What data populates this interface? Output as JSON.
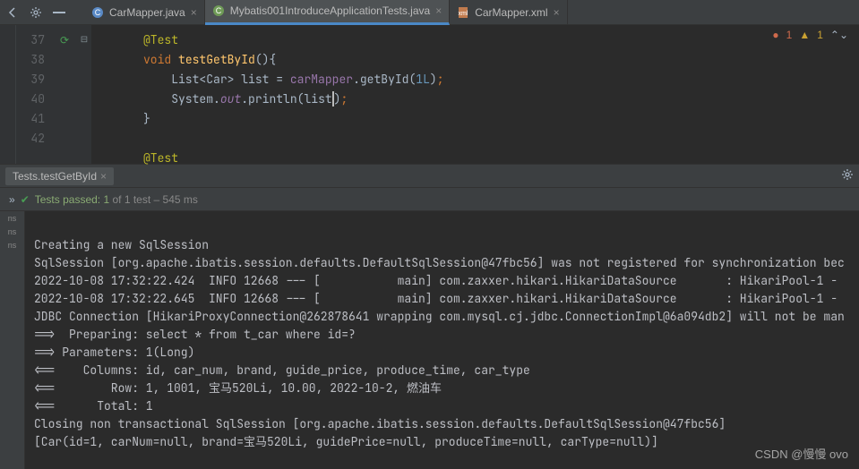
{
  "toolbar": {
    "tabs": [
      {
        "label": "CarMapper.java",
        "type": "java",
        "active": false
      },
      {
        "label": "Mybatis001IntroduceApplicationTests.java",
        "type": "java",
        "active": true
      },
      {
        "label": "CarMapper.xml",
        "type": "xml",
        "active": false
      }
    ]
  },
  "editor": {
    "badges": {
      "errors": "1",
      "warnings": "1"
    },
    "lines": [
      {
        "n": "37",
        "annotation": "@Test"
      },
      {
        "n": "38",
        "method_decl": {
          "kw": "void",
          "name": "testGetById",
          "open": "(){"
        }
      },
      {
        "n": "39",
        "stmt1": {
          "list_type": "List",
          "gen_open": "<",
          "gen_type": "Car",
          "gen_close": ">",
          "var": "list",
          "eq": " = ",
          "recv": "carMapper",
          "dot": ".",
          "call": "getById",
          "args_open": "(",
          "arg": "1L",
          "args_close": ")",
          "semi": ";"
        }
      },
      {
        "n": "40",
        "stmt2": {
          "sys": "System",
          "dot1": ".",
          "out": "out",
          "dot2": ".",
          "call": "println",
          "args_open": "(",
          "arg": "list",
          "args_close": ")",
          "semi": ";"
        }
      },
      {
        "n": "41",
        "close1": "}"
      },
      {
        "n": "42",
        "blank": ""
      },
      {
        "n": "",
        "annotation2": "@Test"
      }
    ]
  },
  "run": {
    "tab": "Tests.testGetById",
    "status_prefix": "Tests passed: ",
    "status_count": "1",
    "status_of": " of 1 test",
    "status_time": " – 545 ms"
  },
  "console": {
    "lines": [
      "Creating a new SqlSession",
      "SqlSession [org.apache.ibatis.session.defaults.DefaultSqlSession@47fbc56] was not registered for synchronization bec",
      "2022-10-08 17:32:22.424  INFO 12668 --- [           main] com.zaxxer.hikari.HikariDataSource       : HikariPool-1 - ",
      "2022-10-08 17:32:22.645  INFO 12668 --- [           main] com.zaxxer.hikari.HikariDataSource       : HikariPool-1 - ",
      "JDBC Connection [HikariProxyConnection@262878641 wrapping com.mysql.cj.jdbc.ConnectionImpl@6a094db2] will not be man",
      "==>  Preparing: select * from t_car where id=?",
      "==> Parameters: 1(Long)",
      "<==    Columns: id, car_num, brand, guide_price, produce_time, car_type",
      "<==        Row: 1, 1001, 宝马520Li, 10.00, 2022-10-2, 燃油车",
      "<==      Total: 1",
      "Closing non transactional SqlSession [org.apache.ibatis.session.defaults.DefaultSqlSession@47fbc56]",
      "[Car(id=1, carNum=null, brand=宝马520Li, guidePrice=null, produceTime=null, carType=null)]"
    ]
  },
  "watermark": "CSDN @慢慢 ovo"
}
